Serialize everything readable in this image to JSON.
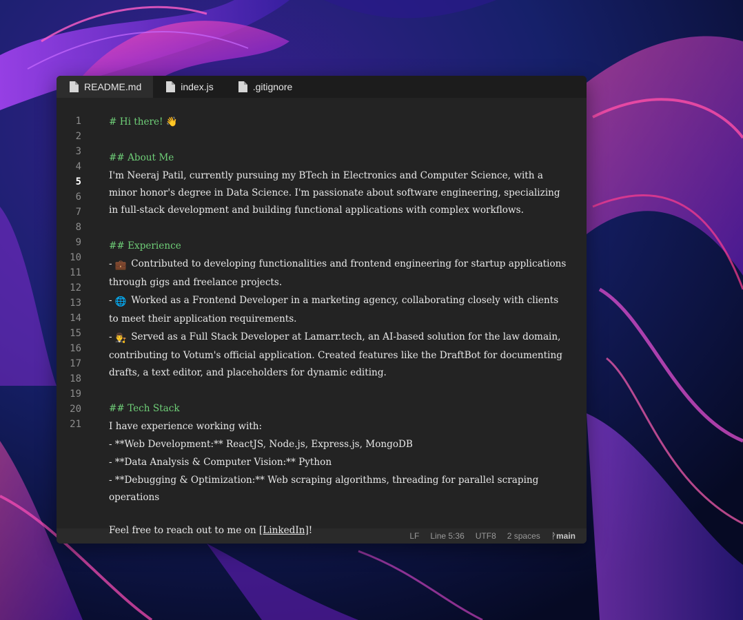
{
  "tabs": [
    {
      "label": "README.md",
      "icon": "file-icon",
      "active": true
    },
    {
      "label": "index.js",
      "icon": "file-icon",
      "active": false
    },
    {
      "label": ".gitignore",
      "icon": "file-icon",
      "active": false
    }
  ],
  "editor": {
    "line_numbers": [
      "1",
      "2",
      "3",
      "4",
      "5",
      "6",
      "7",
      "8",
      "9",
      "10",
      "11",
      "12",
      "13",
      "14",
      "15",
      "16",
      "17",
      "18",
      "19",
      "20",
      "21"
    ],
    "current_line": "5",
    "content": {
      "h1": "# Hi there! 👋",
      "about_heading": "## About Me",
      "about_text": "I'm Neeraj Patil, currently pursuing my BTech in Electronics and Computer Science, with a minor honor's degree in Data Science. I'm passionate about software engineering, specializing in full-stack development and building functional applications with complex workflows.",
      "experience_heading": "## Experience",
      "exp1_prefix": "- ",
      "exp1_emoji": "💼",
      "exp1_text": "Contributed to developing functionalities and frontend engineering for startup applications through gigs and freelance projects.",
      "exp2_prefix": "- ",
      "exp2_emoji": "🌐",
      "exp2_text": "Worked as a Frontend Developer in a marketing agency, collaborating closely with clients to meet their application requirements.",
      "exp3_prefix": "- ",
      "exp3_emoji": "👨‍⚖️",
      "exp3_text": "Served as a Full Stack Developer at Lamarr.tech, an AI-based solution for the law domain, contributing to Votum's official application. Created features like the DraftBot for documenting drafts, a text editor, and placeholders for dynamic editing.",
      "tech_heading": "## Tech Stack",
      "tech_intro": "I have experience working with:",
      "tech1": "- **Web Development:** ReactJS, Node.js, Express.js, MongoDB",
      "tech2": "- **Data Analysis & Computer Vision:** Python",
      "tech3": "- **Debugging & Optimization:** Web scraping algorithms, threading for parallel scraping operations",
      "closing_prefix": "Feel free to reach out to me on ",
      "closing_link": "[LinkedIn]",
      "closing_suffix": "!"
    }
  },
  "statusbar": {
    "line_ending": "LF",
    "cursor": "Line 5:36",
    "encoding": "UTF8",
    "indent": "2 spaces",
    "branch": "main"
  },
  "colors": {
    "heading": "#6fcf78",
    "editor_bg": "#232323",
    "tabbar_bg": "#1c1c1c"
  }
}
